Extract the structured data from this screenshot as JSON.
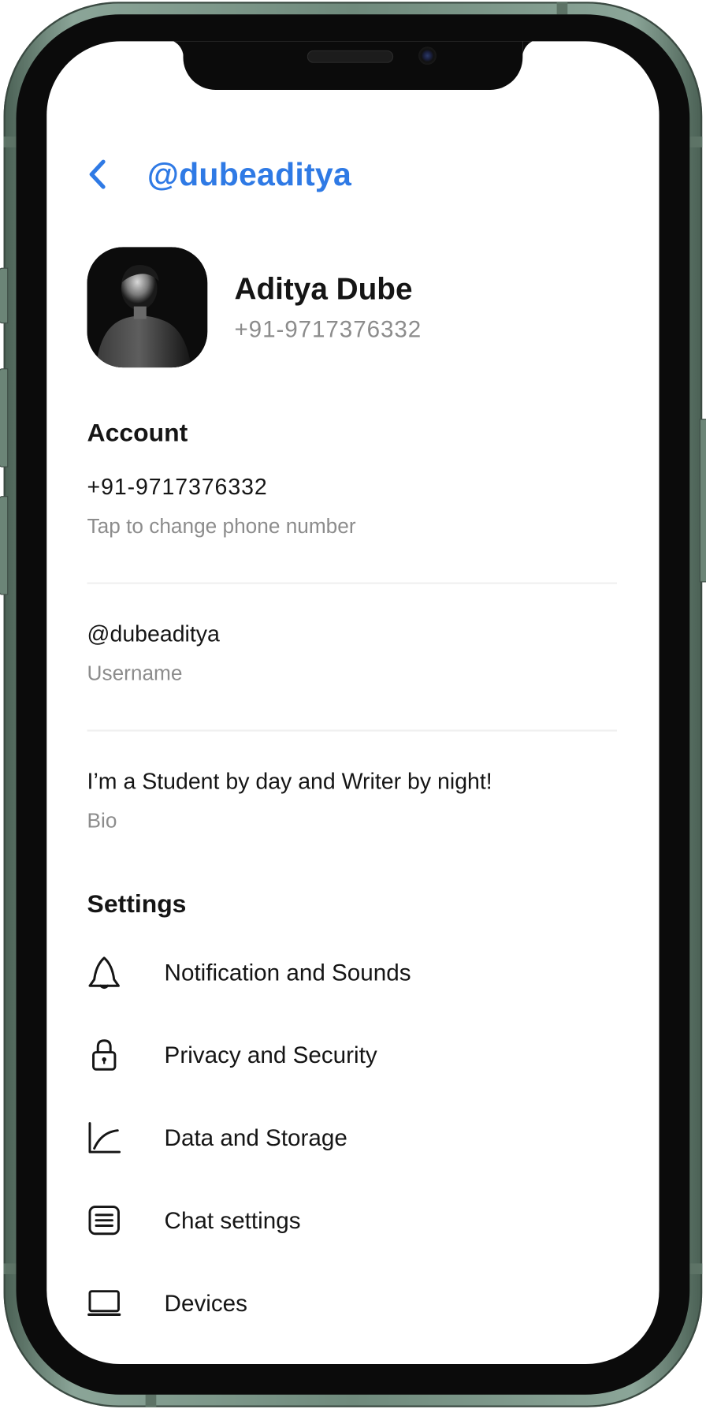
{
  "header": {
    "title": "@dubeaditya",
    "back_icon": "chevron-left-icon",
    "accent_color": "#2f7ae5"
  },
  "profile": {
    "name": "Aditya Dube",
    "phone": "+91-9717376332",
    "avatar": "profile-photo"
  },
  "account": {
    "title": "Account",
    "phone": {
      "value": "+91-9717376332",
      "label": "Tap to change phone number"
    },
    "username": {
      "value": "@dubeaditya",
      "label": "Username"
    },
    "bio": {
      "value": "I’m a Student by day and Writer by night!",
      "label": "Bio"
    }
  },
  "settings": {
    "title": "Settings",
    "items": [
      {
        "label": "Notification and Sounds",
        "icon": "bell-icon"
      },
      {
        "label": "Privacy and Security",
        "icon": "lock-icon"
      },
      {
        "label": "Data and Storage",
        "icon": "chart-icon"
      },
      {
        "label": "Chat settings",
        "icon": "chat-list-icon"
      },
      {
        "label": "Devices",
        "icon": "laptop-icon"
      }
    ]
  }
}
